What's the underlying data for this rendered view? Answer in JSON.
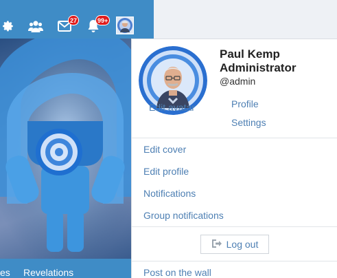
{
  "topbar": {
    "messages_badge": "27",
    "notifications_badge": "99+"
  },
  "hero_nav": {
    "item_partial": "es",
    "item_revelations": "Revelations"
  },
  "profile": {
    "name": "Paul Kemp",
    "role": "Administrator",
    "handle": "@admin",
    "edit_avatar": "Edit avatar"
  },
  "menu": {
    "profile": "Profile",
    "settings": "Settings",
    "edit_cover": "Edit cover",
    "edit_profile": "Edit profile",
    "notifications": "Notifications",
    "group_notifications": "Group notifications",
    "logout": "Log out",
    "post_on_wall": "Post on the wall"
  },
  "colors": {
    "topbar": "#3f8cc6",
    "link": "#4d7fb3",
    "badge": "#e01b1b"
  }
}
